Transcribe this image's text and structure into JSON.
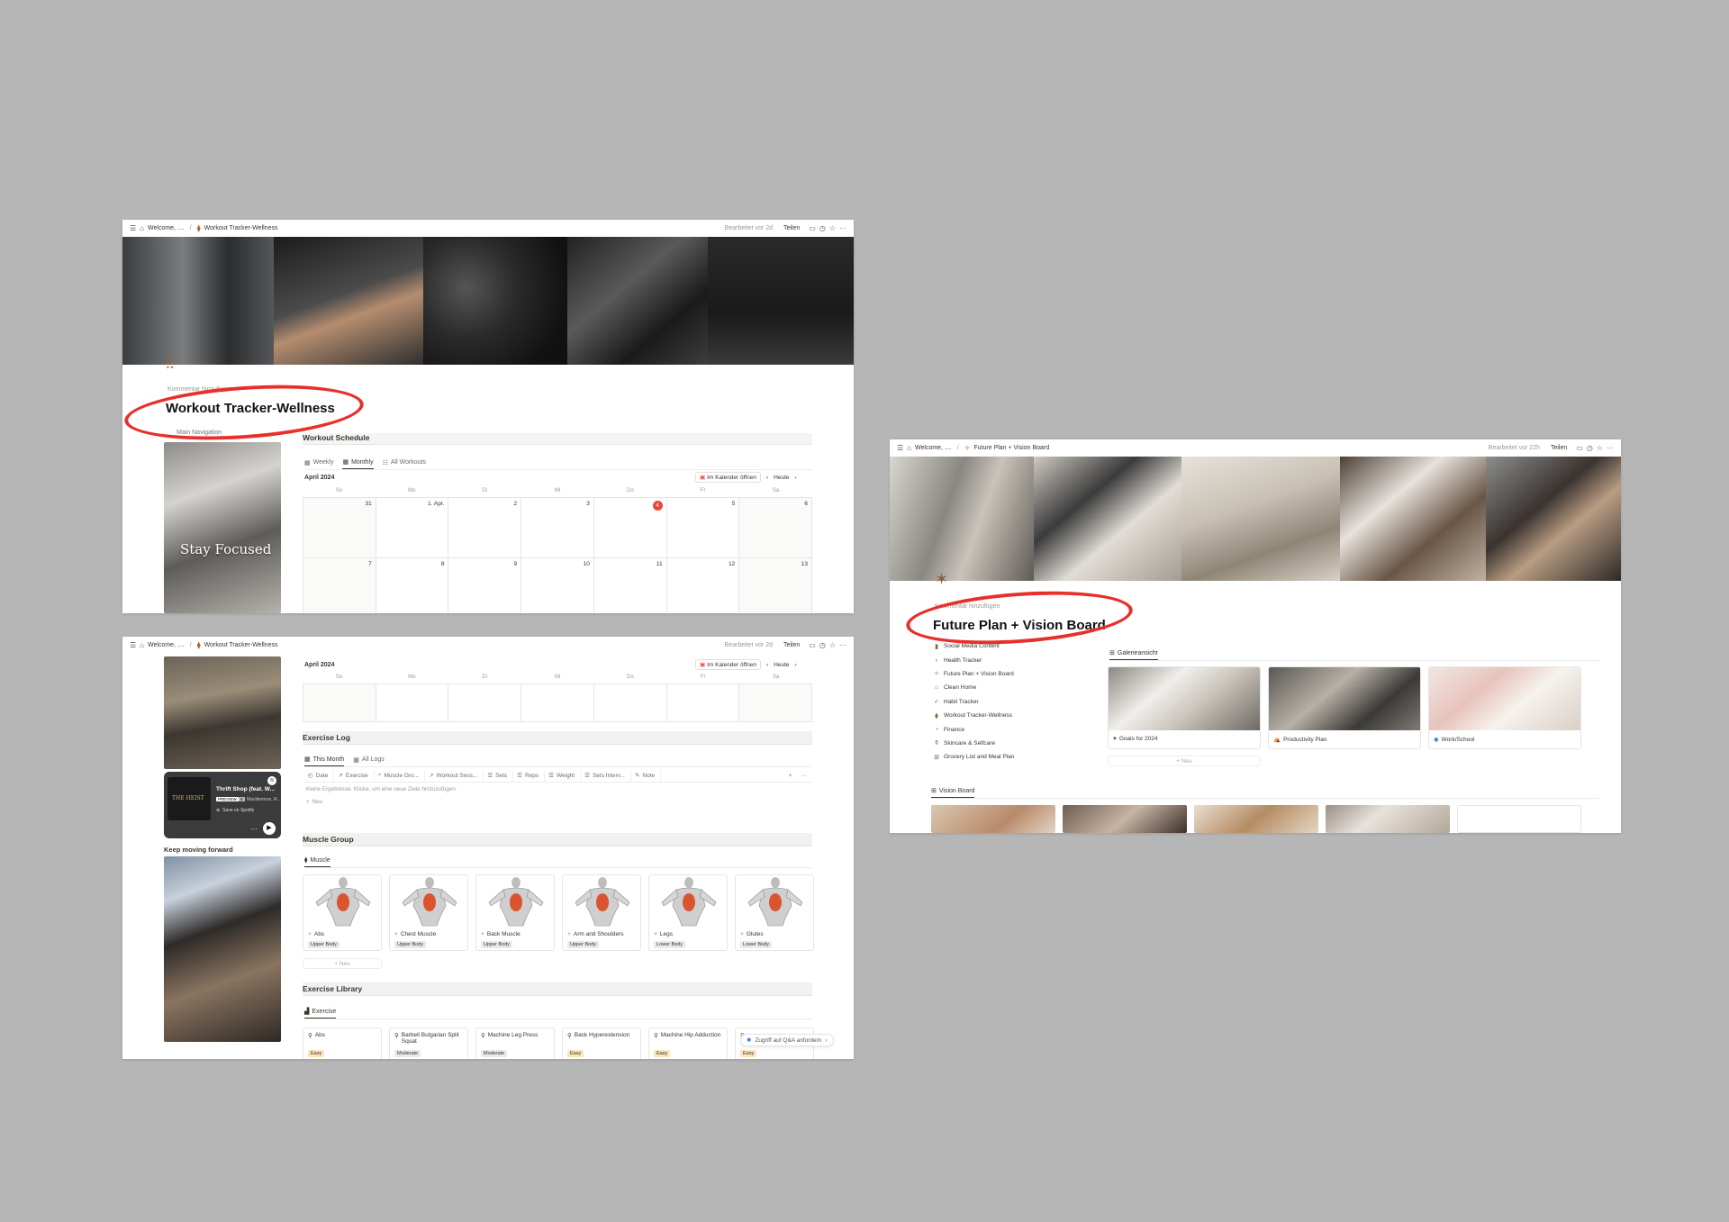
{
  "windows": [
    {
      "id": "workout-top",
      "topbar": {
        "breadcrumb_root": "Welcome, ....",
        "breadcrumb_page": "Workout Tracker-Wellness",
        "edited": "Bearbeitet vor 2d",
        "share": "Teilen"
      },
      "title": "Workout Tracker-Wellness",
      "comment_hint": "Kommentar hinzufügen",
      "main_nav_label": "Main Navigation",
      "image_caption": "Stay Focused",
      "schedule_heading": "Workout Schedule",
      "schedule_tabs": [
        "Weekly",
        "Monthly",
        "All Workouts"
      ],
      "calendar": {
        "month": "April 2024",
        "open_label": "Im Kalender öffnen",
        "today_label": "Heute",
        "weekdays": [
          "So",
          "Mo",
          "Di",
          "Mi",
          "Do",
          "Fr",
          "Sa"
        ],
        "week1": [
          "31",
          "1. Apr.",
          "2",
          "3",
          "4",
          "5",
          "6"
        ],
        "week2": [
          "7",
          "8",
          "9",
          "10",
          "11",
          "12",
          "13"
        ],
        "today": "4"
      }
    },
    {
      "id": "workout-bottom",
      "topbar": {
        "breadcrumb_root": "Welcome, ....",
        "breadcrumb_page": "Workout Tracker-Wellness",
        "edited": "Bearbeitet vor 2d",
        "share": "Teilen"
      },
      "calendar": {
        "month": "April 2024",
        "open_label": "Im Kalender öffnen",
        "today_label": "Heute",
        "weekdays": [
          "So",
          "Mo",
          "Di",
          "Mi",
          "Do",
          "Fr",
          "Sa"
        ]
      },
      "spotify": {
        "track": "Thrift Shop (feat. W...",
        "badge": "PREVIEW",
        "explicit": "E",
        "artist": "Macklemore, R...",
        "save": "Save on Spotify",
        "album_text": "THE HEIST"
      },
      "keep_moving": "Keep moving forward",
      "exercise_log": {
        "heading": "Exercise Log",
        "tabs": [
          "This Month",
          "All Logs"
        ],
        "columns": [
          "Date",
          "Exercise",
          "Muscle Gro...",
          "Workout Sess...",
          "Sets",
          "Reps",
          "Weight",
          "Sets Interv...",
          "Note"
        ],
        "empty_text": "Keine Ergebnisse. Klicke, um eine neue Zeile hinzuzufügen.",
        "new_label": "Neu"
      },
      "muscle_group": {
        "heading": "Muscle Group",
        "tab": "Muscle",
        "cards": [
          {
            "name": "Abs",
            "tag": "Upper Body"
          },
          {
            "name": "Chest Muscle",
            "tag": "Upper Body"
          },
          {
            "name": "Back Muscle",
            "tag": "Upper Body"
          },
          {
            "name": "Arm and Shoulders",
            "tag": "Upper Body"
          },
          {
            "name": "Legs",
            "tag": "Lower Body"
          },
          {
            "name": "Glutes",
            "tag": "Lower Body"
          }
        ],
        "new_label": "Neu"
      },
      "exercise_library": {
        "heading": "Exercise Library",
        "tab": "Exercise",
        "cards": [
          {
            "name": "Abs",
            "tag": "Easy"
          },
          {
            "name": "Barbell Bulgarian Split Squat",
            "tag": "Moderate"
          },
          {
            "name": "Machine Leg Press",
            "tag": "Moderate"
          },
          {
            "name": "Back Hyperextension",
            "tag": "Easy"
          },
          {
            "name": "Machine Hip Adduction",
            "tag": "Easy"
          },
          {
            "name": "",
            "tag": "Easy"
          }
        ]
      },
      "qa_button": "Zugriff auf Q&A anfordern"
    },
    {
      "id": "vision",
      "topbar": {
        "breadcrumb_root": "Welcome, ....",
        "breadcrumb_page": "Future Plan + Vision Board",
        "edited": "Bearbeitet vor 22h",
        "share": "Teilen"
      },
      "title": "Future Plan + Vision Board",
      "comment_hint": "Kommentar hinzufügen",
      "nav_items": [
        "Social Media Content",
        "Health Tracker",
        "Future Plan + Vision Board",
        "Clean Home",
        "Habit Tracker",
        "Workout Tracker-Wellness",
        "Finance",
        "Skincare & Selfcare",
        "Grocery List and Meal Plan"
      ],
      "gallery_tab": "Galerieansicht",
      "gallery": [
        "Goals for 2024",
        "Productivity Plan",
        "Work/School"
      ],
      "new_label": "Neu",
      "vision_tab": "Vision Board"
    }
  ]
}
